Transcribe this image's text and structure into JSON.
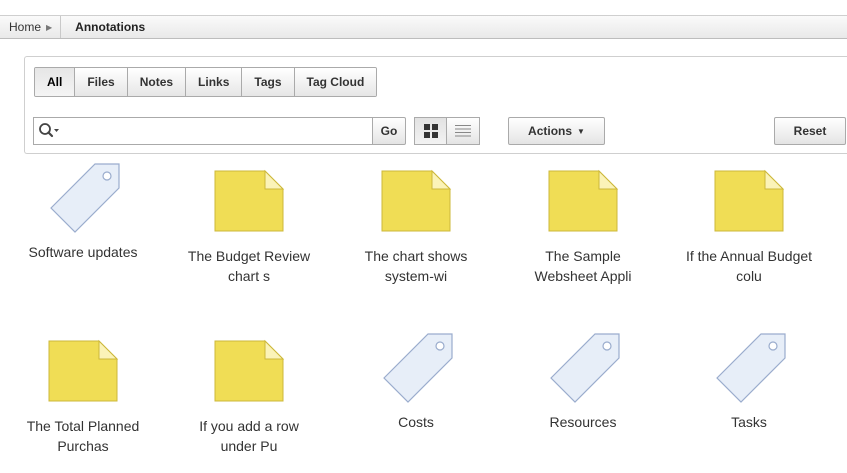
{
  "breadcrumb": {
    "home_label": "Home",
    "current_label": "Annotations"
  },
  "tabs": [
    {
      "label": "All",
      "active": true
    },
    {
      "label": "Files",
      "active": false
    },
    {
      "label": "Notes",
      "active": false
    },
    {
      "label": "Links",
      "active": false
    },
    {
      "label": "Tags",
      "active": false
    },
    {
      "label": "Tag Cloud",
      "active": false
    }
  ],
  "search": {
    "value": "",
    "placeholder": ""
  },
  "toolbar": {
    "go_label": "Go",
    "actions_label": "Actions",
    "reset_label": "Reset",
    "active_view": "icons"
  },
  "colors": {
    "note_fill": "#f0dd55",
    "note_border": "#cdb83a",
    "tag_fill": "#e7eef8",
    "tag_border": "#9aaccd"
  },
  "items": [
    {
      "icon": "tag-icon",
      "label": "Software updates"
    },
    {
      "icon": "note-icon",
      "label": "The Budget Review\nchart s"
    },
    {
      "icon": "note-icon",
      "label": "The chart shows\nsystem-wi"
    },
    {
      "icon": "note-icon",
      "label": "The Sample\nWebsheet Appli"
    },
    {
      "icon": "note-icon",
      "label": "If the Annual Budget\ncolu"
    },
    {
      "icon": "note-icon",
      "label": "The Total Planned\nPurchas"
    },
    {
      "icon": "note-icon",
      "label": "If you add a row\nunder Pu"
    },
    {
      "icon": "tag-icon",
      "label": "Costs"
    },
    {
      "icon": "tag-icon",
      "label": "Resources"
    },
    {
      "icon": "tag-icon",
      "label": "Tasks"
    }
  ]
}
